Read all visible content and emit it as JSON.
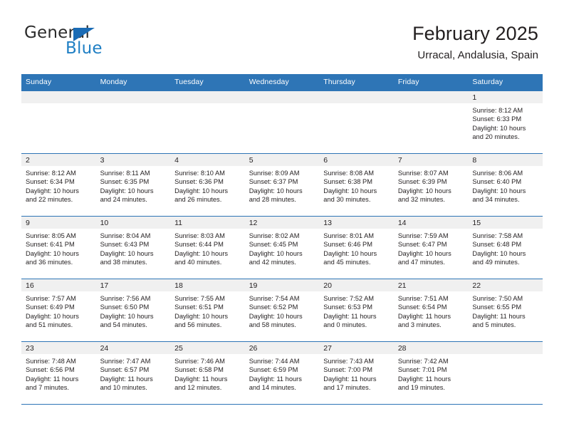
{
  "brand": {
    "name_top": "General",
    "name_bottom": "Blue",
    "triangle_icon": "triangle-icon",
    "color_dark": "#2b2b2b",
    "color_blue": "#1f7fc4"
  },
  "header": {
    "title": "February 2025",
    "subtitle": "Urracal, Andalusia, Spain"
  },
  "theme": {
    "header_row_bg": "#2e75b6",
    "daynum_band_bg": "#f0f0f0",
    "grid_line": "#2e75b6",
    "text": "#231f20"
  },
  "weekday_headers": [
    "Sunday",
    "Monday",
    "Tuesday",
    "Wednesday",
    "Thursday",
    "Friday",
    "Saturday"
  ],
  "weeks": [
    [
      {
        "day": "",
        "sunrise": "",
        "sunset": "",
        "daylight": ""
      },
      {
        "day": "",
        "sunrise": "",
        "sunset": "",
        "daylight": ""
      },
      {
        "day": "",
        "sunrise": "",
        "sunset": "",
        "daylight": ""
      },
      {
        "day": "",
        "sunrise": "",
        "sunset": "",
        "daylight": ""
      },
      {
        "day": "",
        "sunrise": "",
        "sunset": "",
        "daylight": ""
      },
      {
        "day": "",
        "sunrise": "",
        "sunset": "",
        "daylight": ""
      },
      {
        "day": "1",
        "sunrise": "Sunrise: 8:12 AM",
        "sunset": "Sunset: 6:33 PM",
        "daylight": "Daylight: 10 hours and 20 minutes."
      }
    ],
    [
      {
        "day": "2",
        "sunrise": "Sunrise: 8:12 AM",
        "sunset": "Sunset: 6:34 PM",
        "daylight": "Daylight: 10 hours and 22 minutes."
      },
      {
        "day": "3",
        "sunrise": "Sunrise: 8:11 AM",
        "sunset": "Sunset: 6:35 PM",
        "daylight": "Daylight: 10 hours and 24 minutes."
      },
      {
        "day": "4",
        "sunrise": "Sunrise: 8:10 AM",
        "sunset": "Sunset: 6:36 PM",
        "daylight": "Daylight: 10 hours and 26 minutes."
      },
      {
        "day": "5",
        "sunrise": "Sunrise: 8:09 AM",
        "sunset": "Sunset: 6:37 PM",
        "daylight": "Daylight: 10 hours and 28 minutes."
      },
      {
        "day": "6",
        "sunrise": "Sunrise: 8:08 AM",
        "sunset": "Sunset: 6:38 PM",
        "daylight": "Daylight: 10 hours and 30 minutes."
      },
      {
        "day": "7",
        "sunrise": "Sunrise: 8:07 AM",
        "sunset": "Sunset: 6:39 PM",
        "daylight": "Daylight: 10 hours and 32 minutes."
      },
      {
        "day": "8",
        "sunrise": "Sunrise: 8:06 AM",
        "sunset": "Sunset: 6:40 PM",
        "daylight": "Daylight: 10 hours and 34 minutes."
      }
    ],
    [
      {
        "day": "9",
        "sunrise": "Sunrise: 8:05 AM",
        "sunset": "Sunset: 6:41 PM",
        "daylight": "Daylight: 10 hours and 36 minutes."
      },
      {
        "day": "10",
        "sunrise": "Sunrise: 8:04 AM",
        "sunset": "Sunset: 6:43 PM",
        "daylight": "Daylight: 10 hours and 38 minutes."
      },
      {
        "day": "11",
        "sunrise": "Sunrise: 8:03 AM",
        "sunset": "Sunset: 6:44 PM",
        "daylight": "Daylight: 10 hours and 40 minutes."
      },
      {
        "day": "12",
        "sunrise": "Sunrise: 8:02 AM",
        "sunset": "Sunset: 6:45 PM",
        "daylight": "Daylight: 10 hours and 42 minutes."
      },
      {
        "day": "13",
        "sunrise": "Sunrise: 8:01 AM",
        "sunset": "Sunset: 6:46 PM",
        "daylight": "Daylight: 10 hours and 45 minutes."
      },
      {
        "day": "14",
        "sunrise": "Sunrise: 7:59 AM",
        "sunset": "Sunset: 6:47 PM",
        "daylight": "Daylight: 10 hours and 47 minutes."
      },
      {
        "day": "15",
        "sunrise": "Sunrise: 7:58 AM",
        "sunset": "Sunset: 6:48 PM",
        "daylight": "Daylight: 10 hours and 49 minutes."
      }
    ],
    [
      {
        "day": "16",
        "sunrise": "Sunrise: 7:57 AM",
        "sunset": "Sunset: 6:49 PM",
        "daylight": "Daylight: 10 hours and 51 minutes."
      },
      {
        "day": "17",
        "sunrise": "Sunrise: 7:56 AM",
        "sunset": "Sunset: 6:50 PM",
        "daylight": "Daylight: 10 hours and 54 minutes."
      },
      {
        "day": "18",
        "sunrise": "Sunrise: 7:55 AM",
        "sunset": "Sunset: 6:51 PM",
        "daylight": "Daylight: 10 hours and 56 minutes."
      },
      {
        "day": "19",
        "sunrise": "Sunrise: 7:54 AM",
        "sunset": "Sunset: 6:52 PM",
        "daylight": "Daylight: 10 hours and 58 minutes."
      },
      {
        "day": "20",
        "sunrise": "Sunrise: 7:52 AM",
        "sunset": "Sunset: 6:53 PM",
        "daylight": "Daylight: 11 hours and 0 minutes."
      },
      {
        "day": "21",
        "sunrise": "Sunrise: 7:51 AM",
        "sunset": "Sunset: 6:54 PM",
        "daylight": "Daylight: 11 hours and 3 minutes."
      },
      {
        "day": "22",
        "sunrise": "Sunrise: 7:50 AM",
        "sunset": "Sunset: 6:55 PM",
        "daylight": "Daylight: 11 hours and 5 minutes."
      }
    ],
    [
      {
        "day": "23",
        "sunrise": "Sunrise: 7:48 AM",
        "sunset": "Sunset: 6:56 PM",
        "daylight": "Daylight: 11 hours and 7 minutes."
      },
      {
        "day": "24",
        "sunrise": "Sunrise: 7:47 AM",
        "sunset": "Sunset: 6:57 PM",
        "daylight": "Daylight: 11 hours and 10 minutes."
      },
      {
        "day": "25",
        "sunrise": "Sunrise: 7:46 AM",
        "sunset": "Sunset: 6:58 PM",
        "daylight": "Daylight: 11 hours and 12 minutes."
      },
      {
        "day": "26",
        "sunrise": "Sunrise: 7:44 AM",
        "sunset": "Sunset: 6:59 PM",
        "daylight": "Daylight: 11 hours and 14 minutes."
      },
      {
        "day": "27",
        "sunrise": "Sunrise: 7:43 AM",
        "sunset": "Sunset: 7:00 PM",
        "daylight": "Daylight: 11 hours and 17 minutes."
      },
      {
        "day": "28",
        "sunrise": "Sunrise: 7:42 AM",
        "sunset": "Sunset: 7:01 PM",
        "daylight": "Daylight: 11 hours and 19 minutes."
      },
      {
        "day": "",
        "sunrise": "",
        "sunset": "",
        "daylight": ""
      }
    ]
  ]
}
